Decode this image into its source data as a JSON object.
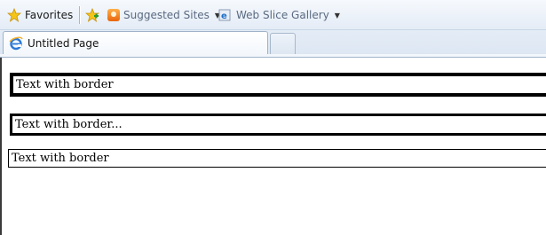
{
  "favorites_bar": {
    "favorites_label": "Favorites",
    "suggested_sites_label": "Suggested Sites",
    "web_slice_gallery_label": "Web Slice Gallery"
  },
  "tabs": {
    "active_title": "Untitled Page"
  },
  "page": {
    "boxes": [
      "Text with border",
      "Text with border...",
      "Text with border"
    ]
  },
  "colors": {
    "chrome_top": "#f6f9fd",
    "chrome_bottom": "#dde7f3",
    "border_color": "#000000"
  }
}
